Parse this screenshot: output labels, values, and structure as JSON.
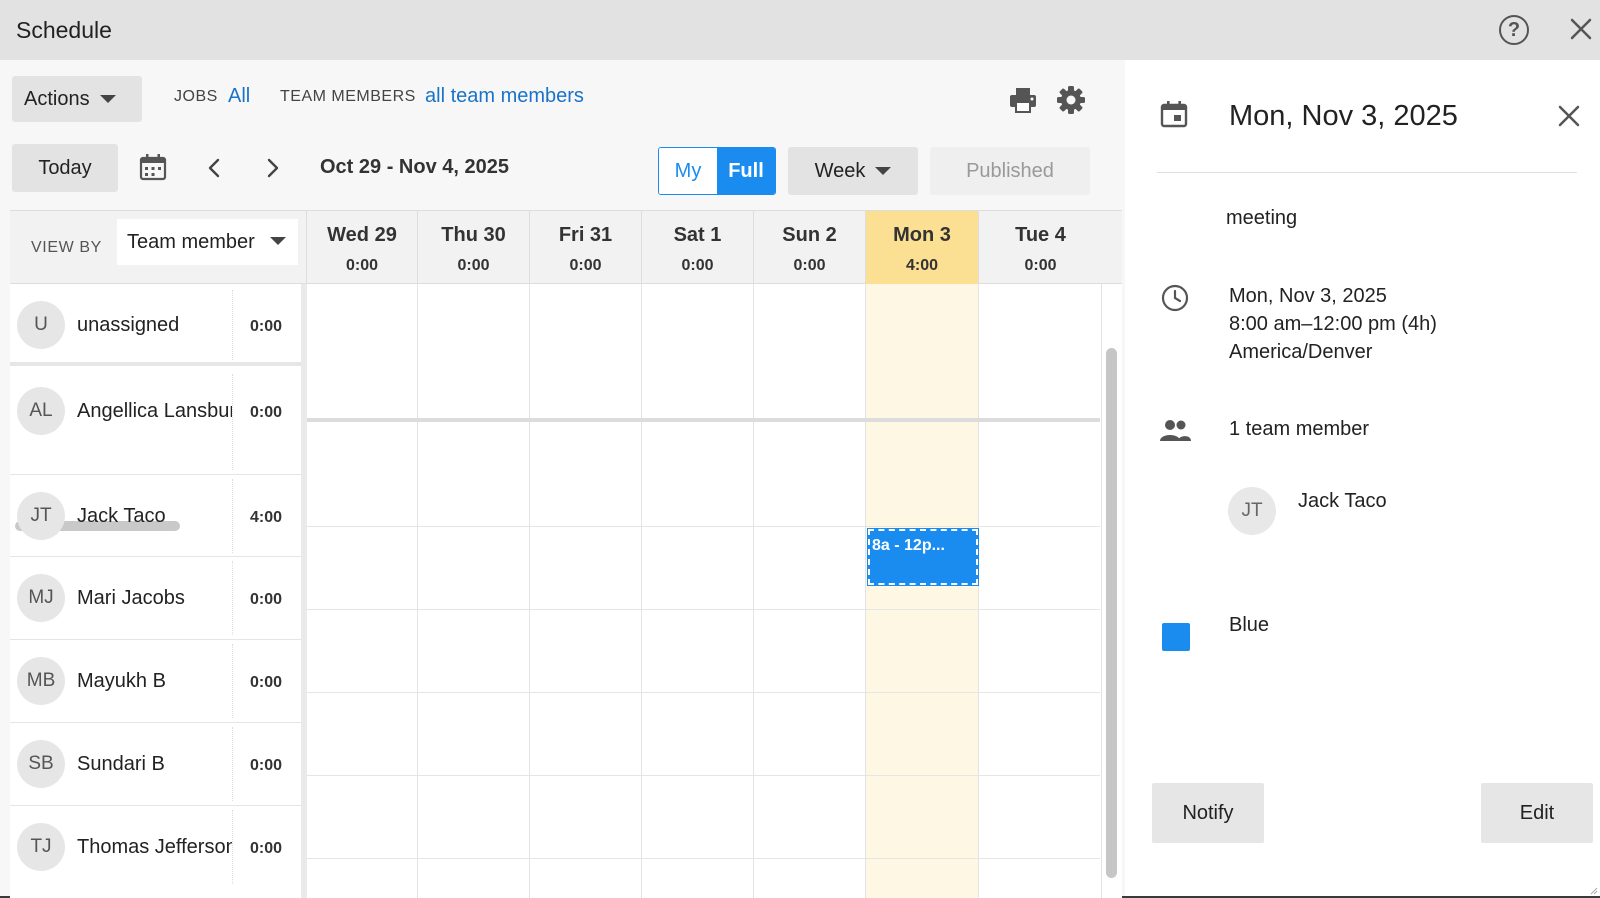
{
  "titlebar": {
    "title": "Schedule"
  },
  "toolbar": {
    "actions_label": "Actions",
    "jobs_label": "JOBS",
    "jobs_value": "All",
    "members_label": "TEAM MEMBERS",
    "members_value": "all team members",
    "today_label": "Today",
    "date_range": "Oct 29 - Nov 4, 2025",
    "toggle": {
      "my": "My",
      "full": "Full",
      "selected": "Full"
    },
    "period_label": "Week",
    "published_label": "Published"
  },
  "grid": {
    "view_by_label": "VIEW BY",
    "view_by_value": "Team member",
    "days": [
      {
        "name": "Wed 29",
        "hours": "0:00"
      },
      {
        "name": "Thu 30",
        "hours": "0:00"
      },
      {
        "name": "Fri 31",
        "hours": "0:00"
      },
      {
        "name": "Sat 1",
        "hours": "0:00"
      },
      {
        "name": "Sun 2",
        "hours": "0:00"
      },
      {
        "name": "Mon 3",
        "hours": "4:00"
      },
      {
        "name": "Tue 4",
        "hours": "0:00"
      }
    ],
    "highlighted_day": "Mon 3",
    "members": [
      {
        "initials": "U",
        "name": "unassigned",
        "hours": "0:00"
      },
      {
        "initials": "AL",
        "name": "Angellica Lansbury",
        "hours": "0:00"
      },
      {
        "initials": "JT",
        "name": "Jack Taco",
        "hours": "4:00"
      },
      {
        "initials": "MJ",
        "name": "Mari Jacobs",
        "hours": "0:00"
      },
      {
        "initials": "MB",
        "name": "Mayukh B",
        "hours": "0:00"
      },
      {
        "initials": "SB",
        "name": "Sundari B",
        "hours": "0:00"
      },
      {
        "initials": "TJ",
        "name": "Thomas Jefferson",
        "hours": "0:00"
      }
    ],
    "event": {
      "label": "8a - 12p...",
      "member": "Jack Taco",
      "day": "Mon 3",
      "color": "#1a8cf0"
    }
  },
  "panel": {
    "date_title": "Mon, Nov 3, 2025",
    "event_title": "meeting",
    "when_date": "Mon, Nov 3, 2025",
    "when_time": "8:00 am–12:00 pm (4h)",
    "timezone": "America/Denver",
    "team_count": "1 team member",
    "member_initials": "JT",
    "member_name": "Jack Taco",
    "color_name": "Blue",
    "color_hex": "#1a8cf0",
    "notify_label": "Notify",
    "edit_label": "Edit"
  },
  "colors": {
    "accent": "#1a8cf0",
    "today_header": "#fbdf92",
    "today_column": "#fdf7e4",
    "link": "#1a73c8"
  }
}
